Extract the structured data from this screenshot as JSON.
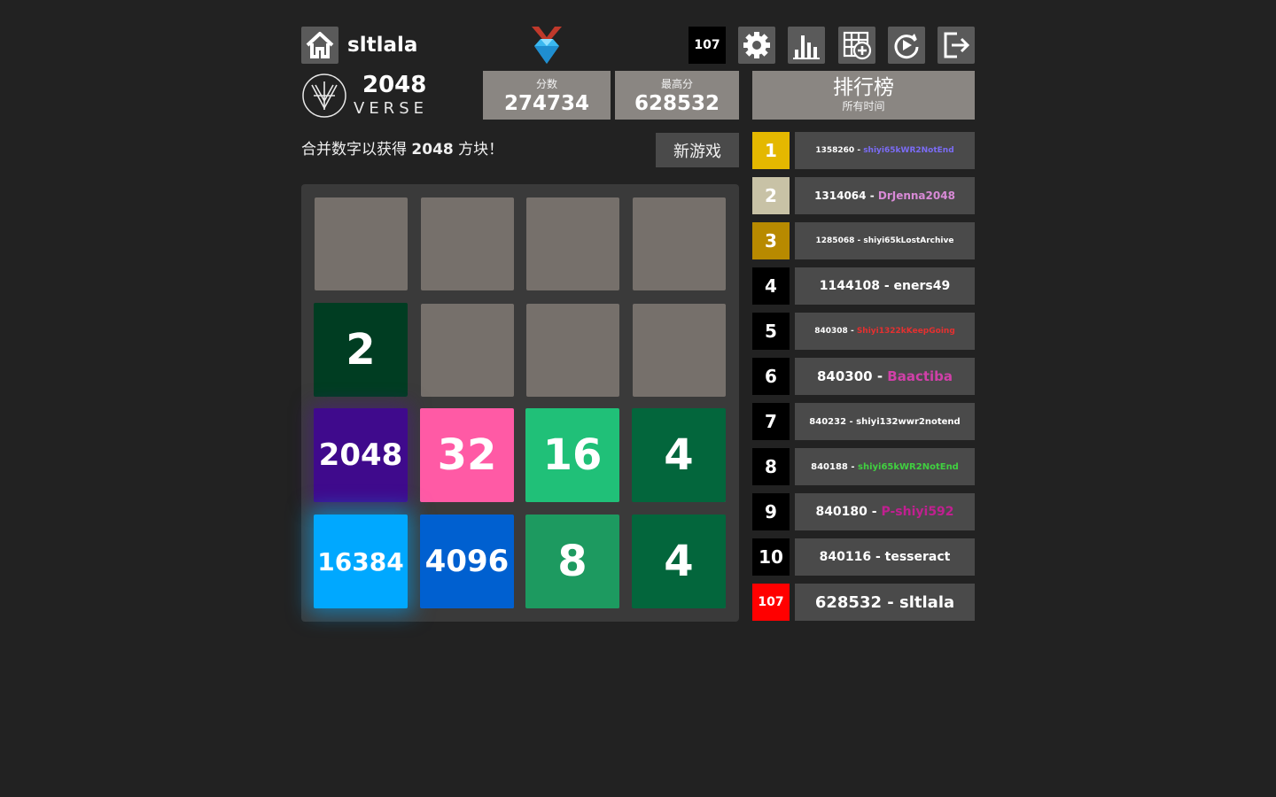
{
  "header": {
    "username": "sltlala",
    "rank_badge": "107",
    "home_icon": "home-icon",
    "tools": [
      "gear-icon",
      "stats-icon",
      "new-board-icon",
      "replay-icon",
      "logout-icon"
    ]
  },
  "brand": {
    "number": "2048",
    "word": "VERSE"
  },
  "score": {
    "label": "分数",
    "value": "274734"
  },
  "best": {
    "label": "最高分",
    "value": "628532"
  },
  "leaderboard": {
    "title": "排行榜",
    "subtitle": "所有时间",
    "entries": [
      {
        "rank": "1",
        "score": "1358260",
        "name": "shiyi65kWR2NotEnd",
        "rank_color": "#e4b800",
        "name_color": "#7b6cf6",
        "size": "9px"
      },
      {
        "rank": "2",
        "score": "1314064",
        "name": "DrJenna2048",
        "rank_color": "#c8c2a6",
        "name_color": "#d88ad6",
        "size": "12px"
      },
      {
        "rank": "3",
        "score": "1285068",
        "name": "shiyi65kLostArchive",
        "rank_color": "#b88a00",
        "name_color": "#ffffff",
        "size": "9px"
      },
      {
        "rank": "4",
        "score": "1144108",
        "name": "eners49",
        "rank_color": "#000000",
        "name_color": "#ffffff",
        "size": "14px"
      },
      {
        "rank": "5",
        "score": "840308",
        "name": "Shiyi1322kKeepGoing",
        "rank_color": "#000000",
        "name_color": "#e53030",
        "size": "9px"
      },
      {
        "rank": "6",
        "score": "840300",
        "name": "Baactiba",
        "rank_color": "#000000",
        "name_color": "#d040a8",
        "size": "15px"
      },
      {
        "rank": "7",
        "score": "840232",
        "name": "shiyi132wwr2notend",
        "rank_color": "#000000",
        "name_color": "#ffffff",
        "size": "10px"
      },
      {
        "rank": "8",
        "score": "840188",
        "name": "shiyi65kWR2NotEnd",
        "rank_color": "#000000",
        "name_color": "#40d040",
        "size": "10px"
      },
      {
        "rank": "9",
        "score": "840180",
        "name": "P-shiyi592",
        "rank_color": "#000000",
        "name_color": "#c02090",
        "size": "14px"
      },
      {
        "rank": "10",
        "score": "840116",
        "name": "tesseract",
        "rank_color": "#000000",
        "name_color": "#ffffff",
        "size": "14px"
      },
      {
        "rank": "107",
        "score": "628532",
        "name": "sltlala",
        "rank_color": "#ff0000",
        "name_color": "#ffffff",
        "size": "18px"
      }
    ]
  },
  "game": {
    "intro_prefix": "合并数字以获得 ",
    "intro_target": "2048",
    "intro_suffix": " 方块！",
    "new_game": "新游戏",
    "tiles": [
      {
        "value": "2",
        "row": 1,
        "col": 0,
        "bg": "#003d22"
      },
      {
        "value": "2048",
        "row": 2,
        "col": 0,
        "bg": "#3f0a8c"
      },
      {
        "value": "32",
        "row": 2,
        "col": 1,
        "bg": "#ff5aa5"
      },
      {
        "value": "16",
        "row": 2,
        "col": 2,
        "bg": "#20c078"
      },
      {
        "value": "4",
        "row": 2,
        "col": 3,
        "bg": "#03663c"
      },
      {
        "value": "16384",
        "row": 3,
        "col": 0,
        "bg": "#00a8ff"
      },
      {
        "value": "4096",
        "row": 3,
        "col": 1,
        "bg": "#0060d0"
      },
      {
        "value": "8",
        "row": 3,
        "col": 2,
        "bg": "#1d9a60"
      },
      {
        "value": "4",
        "row": 3,
        "col": 3,
        "bg": "#03663c"
      }
    ]
  }
}
